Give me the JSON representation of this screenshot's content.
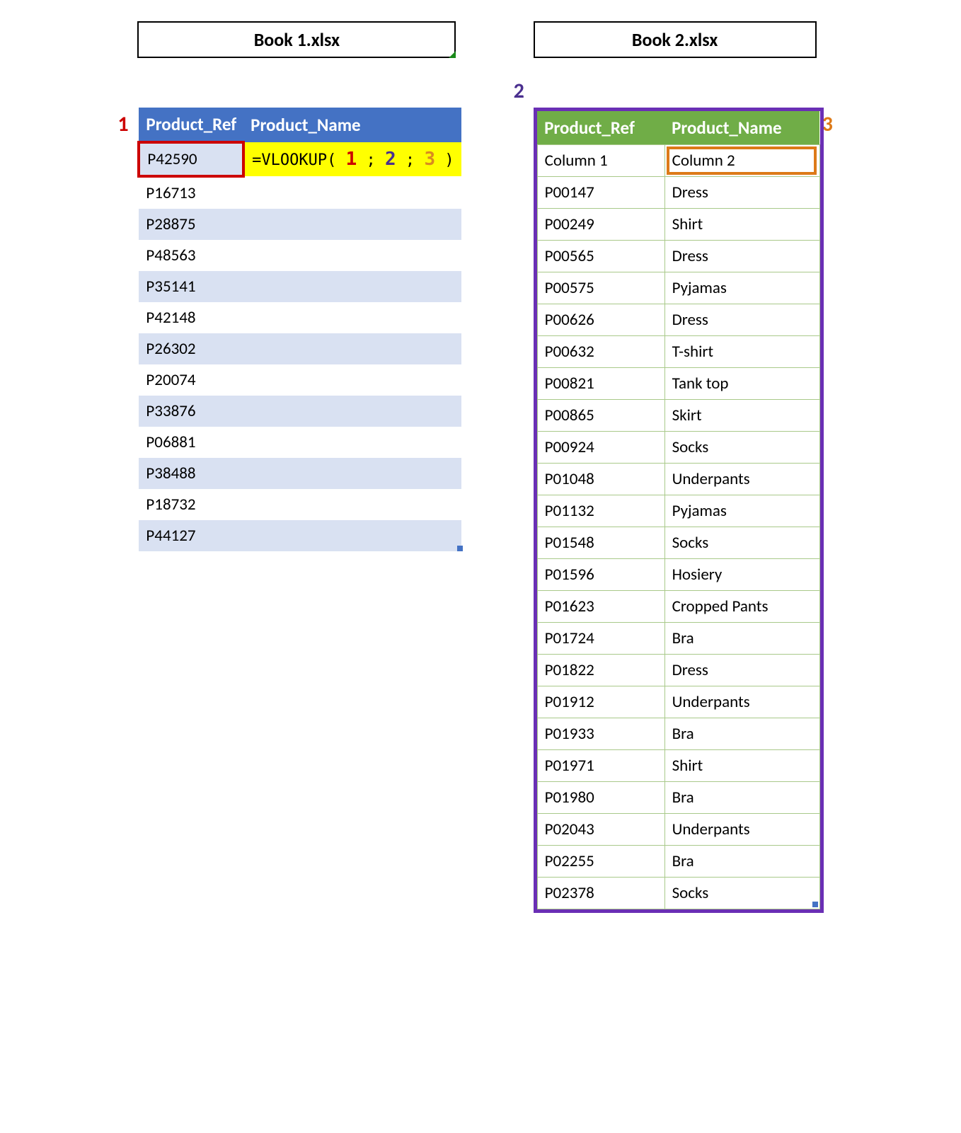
{
  "book1": {
    "title": "Book 1.xlsx",
    "headers": {
      "ref": "Product_Ref",
      "name": "Product_Name"
    },
    "formula": {
      "prefix": "=VLOOKUP(",
      "sep": " ; ",
      "n1": "1",
      "n2": "2",
      "n3": "3",
      "suffix": ")"
    },
    "rows": [
      "P42590",
      "P16713",
      "P28875",
      "P48563",
      "P35141",
      "P42148",
      "P26302",
      "P20074",
      "P33876",
      "P06881",
      "P38488",
      "P18732",
      "P44127"
    ]
  },
  "book2": {
    "title": "Book 2.xlsx",
    "headers": {
      "ref": "Product_Ref",
      "name": "Product_Name"
    },
    "subheaders": {
      "c1": "Column 1",
      "c2": "Column 2"
    },
    "rows": [
      {
        "ref": "P00147",
        "name": "Dress"
      },
      {
        "ref": "P00249",
        "name": "Shirt"
      },
      {
        "ref": "P00565",
        "name": "Dress"
      },
      {
        "ref": "P00575",
        "name": "Pyjamas"
      },
      {
        "ref": "P00626",
        "name": "Dress"
      },
      {
        "ref": "P00632",
        "name": "T-shirt"
      },
      {
        "ref": "P00821",
        "name": "Tank top"
      },
      {
        "ref": "P00865",
        "name": "Skirt"
      },
      {
        "ref": "P00924",
        "name": "Socks"
      },
      {
        "ref": "P01048",
        "name": "Underpants"
      },
      {
        "ref": "P01132",
        "name": "Pyjamas"
      },
      {
        "ref": "P01548",
        "name": "Socks"
      },
      {
        "ref": "P01596",
        "name": "Hosiery"
      },
      {
        "ref": "P01623",
        "name": "Cropped Pants"
      },
      {
        "ref": "P01724",
        "name": "Bra"
      },
      {
        "ref": "P01822",
        "name": "Dress"
      },
      {
        "ref": "P01912",
        "name": "Underpants"
      },
      {
        "ref": "P01933",
        "name": "Bra"
      },
      {
        "ref": "P01971",
        "name": "Shirt"
      },
      {
        "ref": "P01980",
        "name": "Bra"
      },
      {
        "ref": "P02043",
        "name": "Underpants"
      },
      {
        "ref": "P02255",
        "name": "Bra"
      },
      {
        "ref": "P02378",
        "name": "Socks"
      }
    ]
  },
  "callouts": {
    "one": "1",
    "two": "2",
    "three": "3"
  }
}
